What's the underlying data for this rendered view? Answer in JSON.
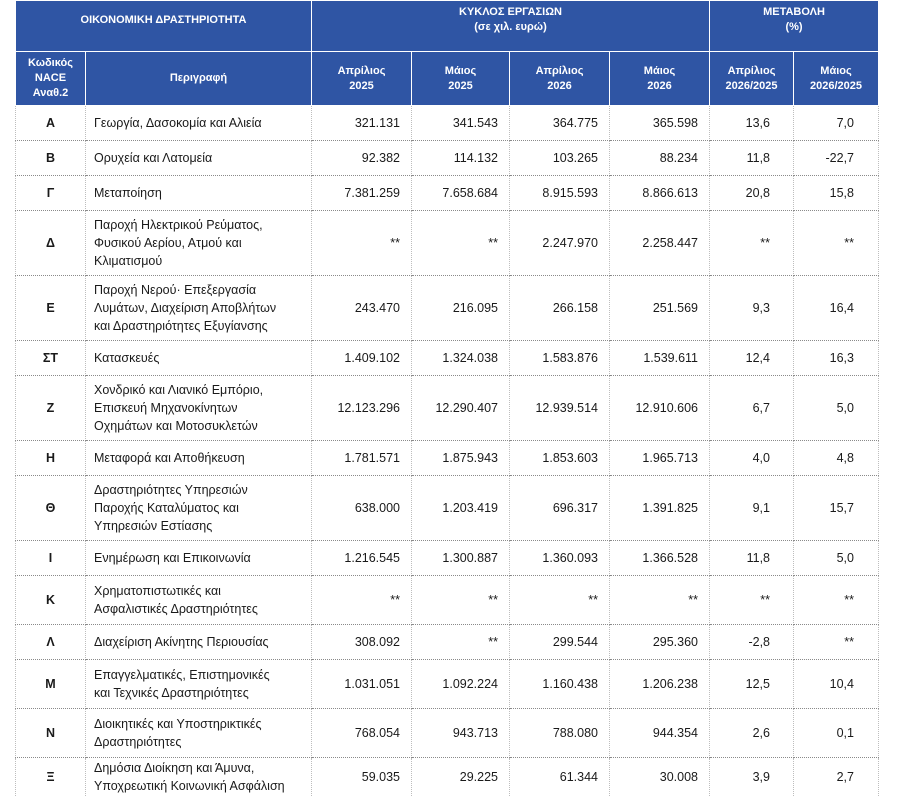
{
  "header": {
    "activity": "ΟΙΚΟΝΟΜΙΚΗ ΔΡΑΣΤΗΡΙΟΤΗΤΑ",
    "turnover": "ΚΥΚΛΟΣ ΕΡΓΑΣΙΩΝ",
    "turnover_unit": "(σε χιλ. ευρώ)",
    "change": "ΜΕΤΑΒΟΛΗ",
    "change_unit": "(%)",
    "code_l1": "Κωδικός",
    "code_l2": "NACE",
    "code_l3": "Αναθ.2",
    "description": "Περιγραφή",
    "apr2025_l1": "Απρίλιος",
    "apr2025_l2": "2025",
    "may2025_l1": "Μάιος",
    "may2025_l2": "2025",
    "apr2026_l1": "Απρίλιος",
    "apr2026_l2": "2026",
    "may2026_l1": "Μάιος",
    "may2026_l2": "2026",
    "chg_apr_l1": "Απρίλιος",
    "chg_apr_l2": "2026/2025",
    "chg_may_l1": "Μάιος",
    "chg_may_l2": "2026/2025"
  },
  "rows": [
    {
      "code": "Α",
      "desc": [
        "Γεωργία, Δασοκομία και Αλιεία"
      ],
      "apr2025": "321.131",
      "may2025": "341.543",
      "apr2026": "364.775",
      "may2026": "365.598",
      "chg_apr": "13,6",
      "chg_may": "7,0"
    },
    {
      "code": "Β",
      "desc": [
        "Ορυχεία και Λατομεία"
      ],
      "apr2025": "92.382",
      "may2025": "114.132",
      "apr2026": "103.265",
      "may2026": "88.234",
      "chg_apr": "11,8",
      "chg_may": "-22,7"
    },
    {
      "code": "Γ",
      "desc": [
        "Μεταποίηση"
      ],
      "apr2025": "7.381.259",
      "may2025": "7.658.684",
      "apr2026": "8.915.593",
      "may2026": "8.866.613",
      "chg_apr": "20,8",
      "chg_may": "15,8"
    },
    {
      "code": "Δ",
      "desc": [
        "Παροχή Ηλεκτρικού Ρεύματος,",
        "Φυσικού Αερίου, Ατμού και",
        "Κλιματισμού"
      ],
      "apr2025": "**",
      "may2025": "**",
      "apr2026": "2.247.970",
      "may2026": "2.258.447",
      "chg_apr": "**",
      "chg_may": "**"
    },
    {
      "code": "Ε",
      "desc": [
        "Παροχή Νερού· Επεξεργασία",
        "Λυμάτων, Διαχείριση Αποβλήτων",
        "και Δραστηριότητες Εξυγίανσης"
      ],
      "apr2025": "243.470",
      "may2025": "216.095",
      "apr2026": "266.158",
      "may2026": "251.569",
      "chg_apr": "9,3",
      "chg_may": "16,4"
    },
    {
      "code": "ΣΤ",
      "desc": [
        "Κατασκευές"
      ],
      "apr2025": "1.409.102",
      "may2025": "1.324.038",
      "apr2026": "1.583.876",
      "may2026": "1.539.611",
      "chg_apr": "12,4",
      "chg_may": "16,3"
    },
    {
      "code": "Ζ",
      "desc": [
        "Χονδρικό και Λιανικό Εμπόριο,",
        "Επισκευή Μηχανοκίνητων",
        "Οχημάτων και Μοτοσυκλετών"
      ],
      "apr2025": "12.123.296",
      "may2025": "12.290.407",
      "apr2026": "12.939.514",
      "may2026": "12.910.606",
      "chg_apr": "6,7",
      "chg_may": "5,0"
    },
    {
      "code": "Η",
      "desc": [
        "Μεταφορά και Αποθήκευση"
      ],
      "apr2025": "1.781.571",
      "may2025": "1.875.943",
      "apr2026": "1.853.603",
      "may2026": "1.965.713",
      "chg_apr": "4,0",
      "chg_may": "4,8"
    },
    {
      "code": "Θ",
      "desc": [
        "Δραστηριότητες Υπηρεσιών",
        "Παροχής Καταλύματος και",
        "Υπηρεσιών Εστίασης"
      ],
      "apr2025": "638.000",
      "may2025": "1.203.419",
      "apr2026": "696.317",
      "may2026": "1.391.825",
      "chg_apr": "9,1",
      "chg_may": "15,7"
    },
    {
      "code": "Ι",
      "desc": [
        "Ενημέρωση και Επικοινωνία"
      ],
      "apr2025": "1.216.545",
      "may2025": "1.300.887",
      "apr2026": "1.360.093",
      "may2026": "1.366.528",
      "chg_apr": "11,8",
      "chg_may": "5,0"
    },
    {
      "code": "Κ",
      "desc": [
        "Χρηματοπιστωτικές και",
        "Ασφαλιστικές Δραστηριότητες"
      ],
      "apr2025": "**",
      "may2025": "**",
      "apr2026": "**",
      "may2026": "**",
      "chg_apr": "**",
      "chg_may": "**"
    },
    {
      "code": "Λ",
      "desc": [
        "Διαχείριση Ακίνητης Περιουσίας"
      ],
      "apr2025": "308.092",
      "may2025": "**",
      "apr2026": "299.544",
      "may2026": "295.360",
      "chg_apr": "-2,8",
      "chg_may": "**"
    },
    {
      "code": "Μ",
      "desc": [
        "Επαγγελματικές, Επιστημονικές",
        "και Τεχνικές Δραστηριότητες"
      ],
      "apr2025": "1.031.051",
      "may2025": "1.092.224",
      "apr2026": "1.160.438",
      "may2026": "1.206.238",
      "chg_apr": "12,5",
      "chg_may": "10,4"
    },
    {
      "code": "Ν",
      "desc": [
        "Διοικητικές και Υποστηρικτικές",
        "Δραστηριότητες"
      ],
      "apr2025": "768.054",
      "may2025": "943.713",
      "apr2026": "788.080",
      "may2026": "944.354",
      "chg_apr": "2,6",
      "chg_may": "0,1"
    },
    {
      "code": "Ξ",
      "desc": [
        "Δημόσια Διοίκηση και Άμυνα,",
        "Υποχρεωτική Κοινωνική Ασφάλιση"
      ],
      "apr2025": "59.035",
      "may2025": "29.225",
      "apr2026": "61.344",
      "may2026": "30.008",
      "chg_apr": "3,9",
      "chg_may": "2,7"
    }
  ]
}
